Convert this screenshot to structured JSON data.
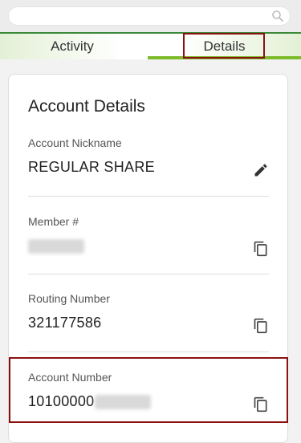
{
  "search": {
    "placeholder": ""
  },
  "tabs": [
    {
      "label": "Activity",
      "active": false
    },
    {
      "label": "Details",
      "active": true
    }
  ],
  "colors": {
    "accent_green": "#7dbb2a",
    "highlight": "#8b1111",
    "top_border": "#3a8a3a"
  },
  "card": {
    "title": "Account Details",
    "fields": [
      {
        "label": "Account Nickname",
        "value": "REGULAR SHARE",
        "action_icon": "edit-icon"
      },
      {
        "label": "Member #",
        "value": "",
        "redacted": true,
        "action_icon": "copy-icon"
      },
      {
        "label": "Routing Number",
        "value": "321177586",
        "action_icon": "copy-icon"
      },
      {
        "label": "Account Number",
        "value": "10100000",
        "redacted_suffix": true,
        "action_icon": "copy-icon"
      }
    ]
  }
}
